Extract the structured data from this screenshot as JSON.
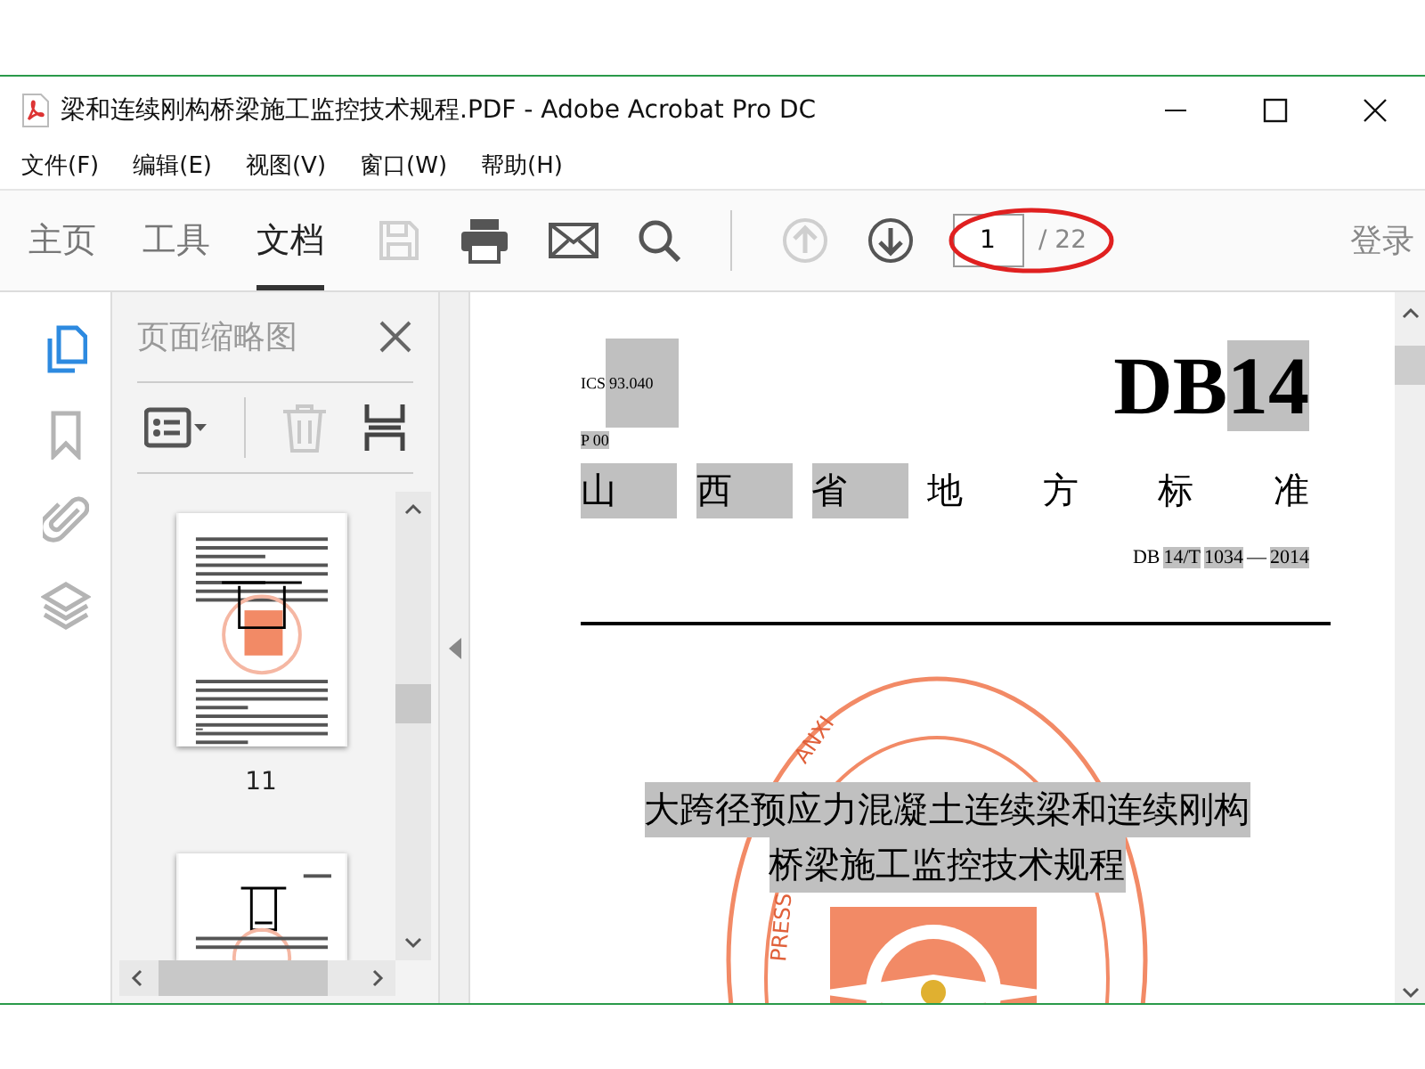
{
  "window": {
    "title": "梁和连续刚构桥梁施工监控技术规程.PDF - Adobe Acrobat Pro DC"
  },
  "menu": [
    "文件(F)",
    "编辑(E)",
    "视图(V)",
    "窗口(W)",
    "帮助(H)"
  ],
  "toolbar": {
    "tabs": [
      {
        "label": "主页",
        "selected": false
      },
      {
        "label": "工具",
        "selected": false
      },
      {
        "label": "文档",
        "selected": true
      }
    ],
    "tools": [
      {
        "kind": "save",
        "disabled": true
      },
      {
        "kind": "print",
        "disabled": false
      },
      {
        "kind": "mail",
        "disabled": false
      },
      {
        "kind": "search",
        "disabled": false
      },
      {
        "kind": "up",
        "disabled": true
      },
      {
        "kind": "down",
        "disabled": false
      }
    ],
    "page_input": {
      "value": "1"
    },
    "page_total": "/ 22",
    "sign_in": "登录"
  },
  "rail": [
    {
      "kind": "pages",
      "selected": true
    },
    {
      "kind": "bookmark",
      "selected": false
    },
    {
      "kind": "attachment",
      "selected": false
    },
    {
      "kind": "layers",
      "selected": false
    }
  ],
  "panel": {
    "title": "页面缩略图",
    "thumbnails": [
      {
        "kind": "full",
        "label": "11"
      },
      {
        "kind": "cut"
      }
    ]
  },
  "document": {
    "ics": [
      {
        "text": "ICS",
        "highlighted": false
      },
      {
        "text": "93.040",
        "highlighted": true
      }
    ],
    "p_code": [
      {
        "text": "P 00",
        "highlighted": true
      }
    ],
    "logo": [
      {
        "text": "DB",
        "highlighted": false
      },
      {
        "text": "14",
        "highlighted": true
      }
    ],
    "standard_type": [
      {
        "text": "山",
        "highlighted": true
      },
      {
        "text": "西",
        "highlighted": true
      },
      {
        "text": "省",
        "highlighted": true
      },
      {
        "text": "地",
        "highlighted": false
      },
      {
        "text": "方",
        "highlighted": false
      },
      {
        "text": "标",
        "highlighted": false
      },
      {
        "text": "准",
        "highlighted": false
      }
    ],
    "number": [
      {
        "text": "DB",
        "highlighted": false
      },
      {
        "text": "14/T",
        "highlighted": true
      },
      {
        "text": "1034",
        "highlighted": true
      },
      {
        "text": "—",
        "highlighted": false
      },
      {
        "text": "2014",
        "highlighted": true
      }
    ],
    "title_lines": [
      {
        "text": "大跨径预应力混凝土连续梁和连续刚构",
        "highlighted": true
      },
      {
        "text": "桥梁施工监控技术规程",
        "highlighted": true
      }
    ],
    "stamp_texts": [
      "PRESS",
      "ANXI"
    ]
  }
}
